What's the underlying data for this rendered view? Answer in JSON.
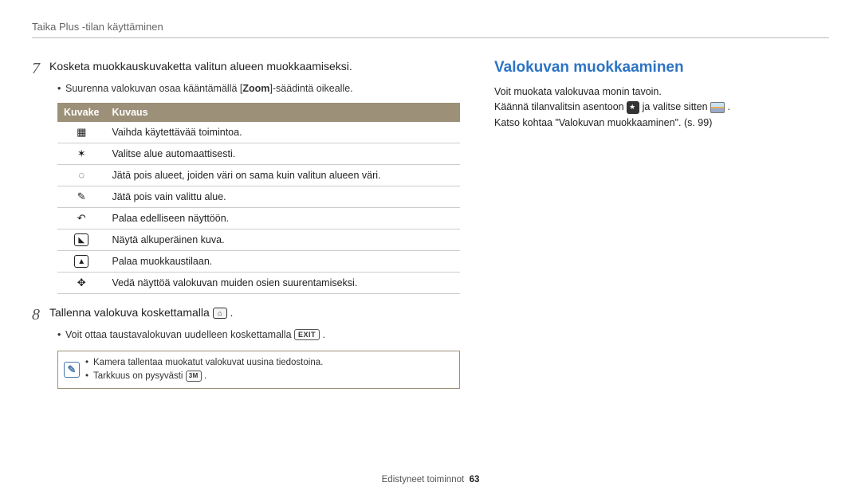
{
  "header": {
    "breadcrumb": "Taika Plus -tilan käyttäminen"
  },
  "left": {
    "step7": {
      "num": "7",
      "text": "Kosketa muokkauskuvaketta valitun alueen muokkaamiseksi.",
      "bullet1_pre": "Suurenna valokuvan osaa kääntämällä [",
      "bullet1_zoom": "Zoom",
      "bullet1_post": "]-säädintä oikealle."
    },
    "table": {
      "head_icon": "Kuvake",
      "head_desc": "Kuvaus",
      "rows": [
        {
          "icon": "function-icon",
          "desc": "Vaihda käytettävää toimintoa."
        },
        {
          "icon": "wand-icon",
          "desc": "Valitse alue automaattisesti."
        },
        {
          "icon": "dotted-circle-icon",
          "desc": "Jätä pois alueet, joiden väri on sama kuin valitun alueen väri."
        },
        {
          "icon": "eraser-icon",
          "desc": "Jätä pois vain valittu alue."
        },
        {
          "icon": "undo-icon",
          "desc": "Palaa edelliseen näyttöön."
        },
        {
          "icon": "original-image-icon",
          "desc": "Näytä alkuperäinen kuva."
        },
        {
          "icon": "image-icon",
          "desc": "Palaa muokkaustilaan."
        },
        {
          "icon": "move-arrows-icon",
          "desc": "Vedä näyttöä valokuvan muiden osien suurentamiseksi."
        }
      ]
    },
    "step8": {
      "num": "8",
      "text_pre": "Tallenna valokuva koskettamalla ",
      "text_post": " .",
      "bullet1_pre": "Voit ottaa taustavalokuvan uudelleen koskettamalla ",
      "exit_label": "EXIT",
      "bullet1_post": " ."
    },
    "note": {
      "line1": "Kamera tallentaa muokatut valokuvat uusina tiedostoina.",
      "line2_pre": "Tarkkuus on pysyvästi ",
      "res_label": "3M",
      "line2_post": " ."
    }
  },
  "right": {
    "title": "Valokuvan muokkaaminen",
    "p1": "Voit muokata valokuvaa monin tavoin.",
    "p2_pre": "Käännä tilanvalitsin asentoon ",
    "p2_mid": " ja valitse sitten ",
    "p2_post": " .",
    "p3": "Katso kohtaa \"Valokuvan muokkaaminen\". (s. 99)"
  },
  "footer": {
    "section": "Edistyneet toiminnot",
    "page": "63"
  }
}
